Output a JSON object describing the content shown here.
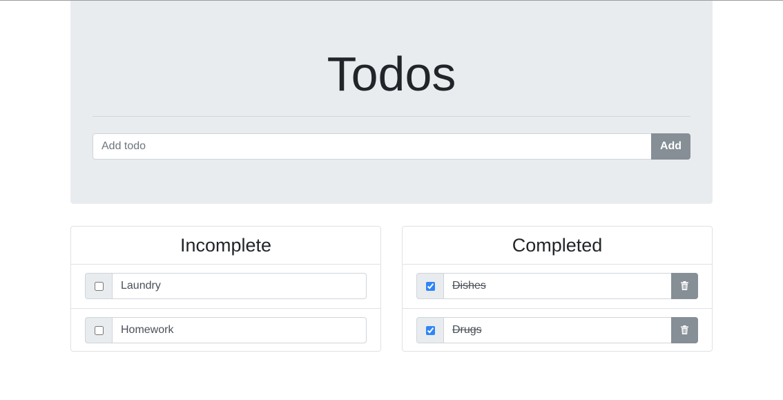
{
  "header": {
    "title": "Todos",
    "add_placeholder": "Add todo",
    "add_input_value": "",
    "add_button_label": "Add"
  },
  "incomplete": {
    "heading": "Incomplete",
    "items": [
      {
        "label": "Laundry",
        "checked": false
      },
      {
        "label": "Homework",
        "checked": false
      }
    ]
  },
  "completed": {
    "heading": "Completed",
    "items": [
      {
        "label": "Dishes",
        "checked": true
      },
      {
        "label": "Drugs",
        "checked": true
      }
    ]
  },
  "colors": {
    "jumbotron_bg": "#e9ecef",
    "button_gray": "#868e96",
    "checkbox_accent": "#2f86f6",
    "border": "#ced4da"
  },
  "icons": {
    "delete": "trash-icon",
    "check": "checkbox"
  }
}
